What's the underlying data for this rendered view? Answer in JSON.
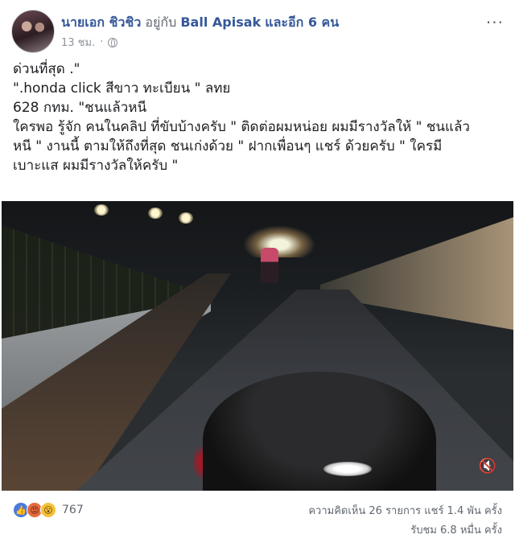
{
  "post": {
    "author": "นายเอก ชิวชิว",
    "with_text": "อยู่กับ",
    "tagged": "Ball Apisak",
    "and_others": "และอีก 6 คน",
    "time": "13 ชม.",
    "more_label": "···",
    "text_lines": [
      "ด่วนที่สุด .\"",
      "\".honda click สีขาว ทะเบียน \" ลทย",
      "628 กทม. \"ชนแล้วหนี",
      "ใครพอ รู้จัก คนในคลิป ที่ขับบ้างครับ \" ติดต่อผมหน่อย ผมมีรางวัลให้ \" ชนแล้ว",
      "หนี \" งานนี้ ตามให้ถึงที่สุด ชนเก่งด้วย \" ฝากเพื่อนๆ แชร์ ด้วยครับ \" ใครมี",
      "เบาะแส ผมมีรางวัลให้ครับ \""
    ]
  },
  "video": {
    "mute_icon": "🔇"
  },
  "footer": {
    "reactions": [
      "👍",
      "😡",
      "😮"
    ],
    "reaction_count": "767",
    "comments_shares": "ความคิดเห็น 26 รายการ  แชร์ 1.4 พัน ครั้ง",
    "views": "รับชม 6.8 หมื่น ครั้ง"
  },
  "colors": {
    "link": "#365899",
    "meta": "#90949c",
    "like": "#4a7bdb"
  }
}
